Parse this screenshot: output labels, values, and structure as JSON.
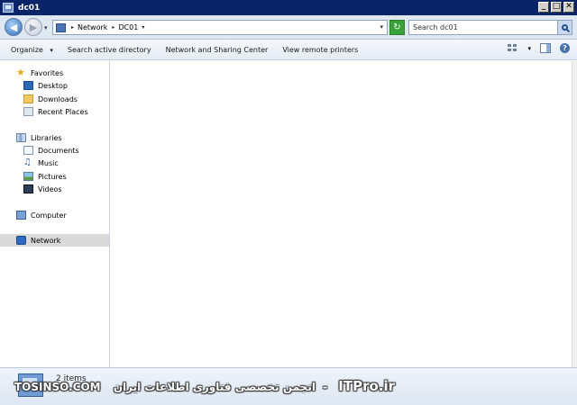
{
  "window": {
    "title": "dc01",
    "controls": [
      "minimize",
      "maximize",
      "close"
    ]
  },
  "address_bar": {
    "breadcrumbs": [
      "Network",
      "DC01"
    ],
    "search_placeholder": "Search dc01"
  },
  "toolbar": {
    "organize_label": "Organize",
    "items": [
      "Search active directory",
      "Network and Sharing Center",
      "View remote printers"
    ]
  },
  "navigation": {
    "favorites": {
      "label": "Favorites",
      "items": [
        "Desktop",
        "Downloads",
        "Recent Places"
      ]
    },
    "libraries": {
      "label": "Libraries",
      "items": [
        "Documents",
        "Music",
        "Pictures",
        "Videos"
      ]
    },
    "computer_label": "Computer",
    "network_label": "Network",
    "selected": "Network"
  },
  "details": {
    "item_count": "2 items"
  },
  "watermark": {
    "site": "TOSINSO.COM",
    "tagline": "انجمن تخصصی فناوری اطلاعات ایران",
    "brand": "ITPro.ir",
    "separator": "-"
  },
  "colors": {
    "title_bar": "#0a246a",
    "selected_nav": "#d9d9d9",
    "toolbar_bg": "#e4ebf4"
  },
  "icons": {
    "favorites": "star-icon",
    "desktop": "desktop-icon",
    "downloads": "folder-icon",
    "recent_places": "recent-places-icon",
    "libraries": "libraries-icon",
    "documents": "document-icon",
    "music": "music-icon",
    "pictures": "pictures-icon",
    "videos": "videos-icon",
    "computer": "computer-icon",
    "network": "network-icon"
  }
}
